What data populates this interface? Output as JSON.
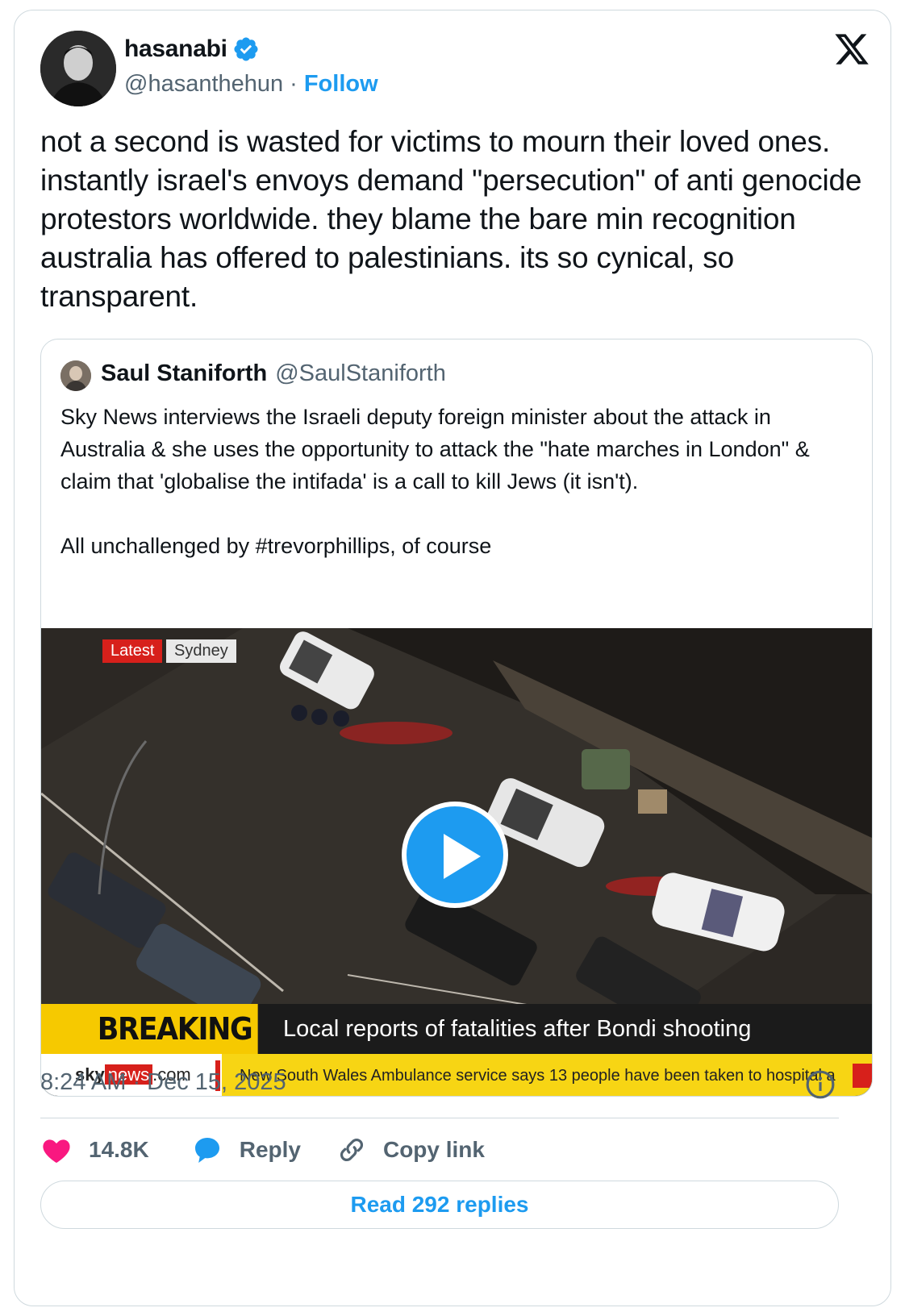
{
  "author": {
    "display_name": "hasanabi",
    "handle": "@hasanthehun",
    "separator": "·",
    "follow_label": "Follow",
    "verified": true
  },
  "platform_icon": "x-logo-icon",
  "tweet": {
    "text": "not a second is wasted for victims to mourn their loved ones. instantly israel's envoys demand \"persecution\" of anti genocide protestors worldwide. they blame the bare min recognition australia has offered to palestinians. its so cynical, so transparent."
  },
  "quote": {
    "display_name": "Saul Staniforth",
    "handle": "@SaulStaniforth",
    "text": "Sky News interviews the Israeli deputy foreign minister about the attack in Australia & she uses the opportunity to attack the \"hate marches in London\" & claim that 'globalise the intifada' is a call to kill Jews (it isn't).\n\nAll unchallenged by #trevorphillips, of course",
    "video": {
      "tag_latest": "Latest",
      "tag_location": "Sydney",
      "breaking_label": "BREAKING NEWS",
      "headline": "Local reports of fatalities after Bondi shooting",
      "logo_sky": "sky",
      "logo_news": "news",
      "logo_com": ".com",
      "ticker": "New South Wales Ambulance service says 13 people have been taken to hospital a",
      "play_icon": "play-icon"
    }
  },
  "meta": {
    "timestamp": "8:24 AM · Dec 15, 2025"
  },
  "actions": {
    "likes": "14.8K",
    "reply_label": "Reply",
    "copy_label": "Copy link"
  },
  "read_replies_label": "Read 292 replies",
  "colors": {
    "accent": "#1d9bf0",
    "like": "#f91880",
    "muted": "#536471",
    "breaking_yellow": "#f6c900",
    "sky_red": "#d7201b"
  }
}
